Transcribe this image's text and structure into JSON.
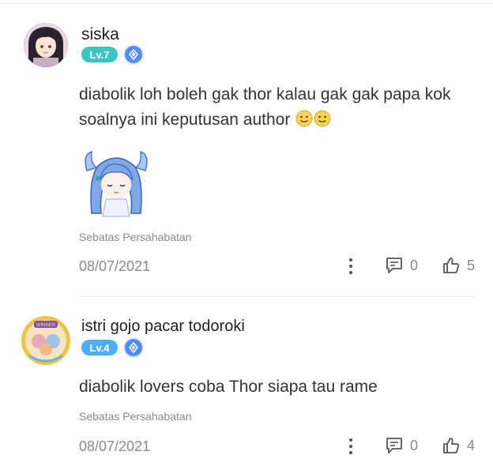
{
  "comments": [
    {
      "username": "siska",
      "level": "Lv.7",
      "level_color": "#3bc4c4",
      "text": "diabolik loh boleh gak thor kalau gak gak papa kok soalnya ini keputusan author",
      "emojis": [
        "slightly-smiling-emoji",
        "slightly-smiling-emoji"
      ],
      "has_sticker": true,
      "chapter": "Sebatas Persahabatan",
      "date": "08/07/2021",
      "reply_count": "0",
      "like_count": "5"
    },
    {
      "username": "istri gojo pacar todoroki",
      "level": "Lv.4",
      "level_color": "#4eaef5",
      "text": "diabolik lovers coba Thor siapa tau rame",
      "emojis": [],
      "has_sticker": false,
      "chapter": "Sebatas Persahabatan",
      "date": "08/07/2021",
      "reply_count": "0",
      "like_count": "4"
    }
  ],
  "icons": {
    "more": "more-vertical-icon",
    "reply": "comment-bubble-icon",
    "like": "thumbs-up-icon",
    "badge": "diamond-badge-icon"
  }
}
